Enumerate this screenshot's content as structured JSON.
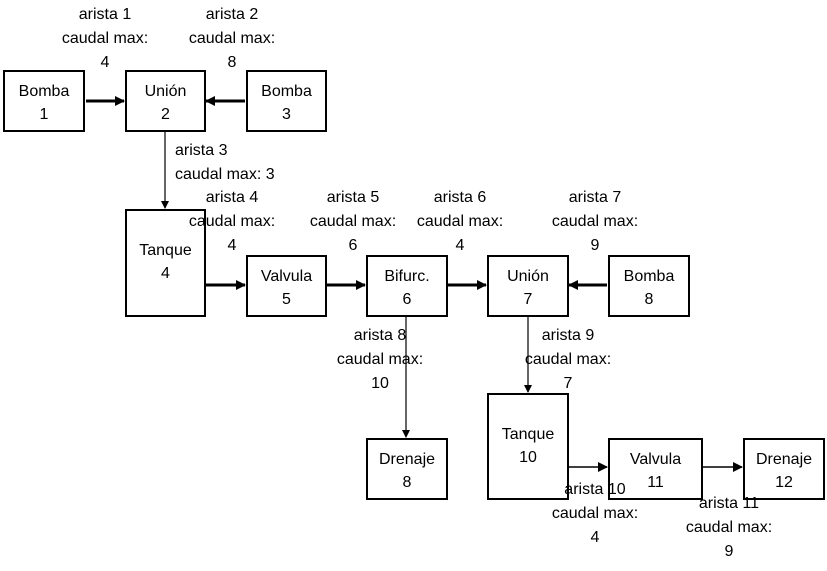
{
  "nodes": [
    {
      "id": "1",
      "type": "Bomba",
      "number": "1"
    },
    {
      "id": "2",
      "type": "Unión",
      "number": "2"
    },
    {
      "id": "3",
      "type": "Bomba",
      "number": "3"
    },
    {
      "id": "4",
      "type": "Tanque",
      "number": "4"
    },
    {
      "id": "5",
      "type": "Valvula",
      "number": "5"
    },
    {
      "id": "6",
      "type": "Bifurc.",
      "number": "6"
    },
    {
      "id": "7",
      "type": "Unión",
      "number": "7"
    },
    {
      "id": "8",
      "type": "Bomba",
      "number": "8"
    },
    {
      "id": "9",
      "type": "Drenaje",
      "number": "8"
    },
    {
      "id": "10",
      "type": "Tanque",
      "number": "10"
    },
    {
      "id": "11",
      "type": "Valvula",
      "number": "11"
    },
    {
      "id": "12",
      "type": "Drenaje",
      "number": "12"
    }
  ],
  "edges": [
    {
      "label": "arista 1",
      "caudal_label": "caudal max:",
      "value": "4",
      "from": "Bomba 1",
      "to": "Unión 2"
    },
    {
      "label": "arista 2",
      "caudal_label": "caudal max:",
      "value": "8",
      "from": "Bomba 3",
      "to": "Unión 2"
    },
    {
      "label": "arista 3",
      "caudal_label": "caudal max: 3",
      "value": "",
      "from": "Unión 2",
      "to": "Tanque 4"
    },
    {
      "label": "arista 4",
      "caudal_label": "caudal max:",
      "value": "4",
      "from": "Tanque 4",
      "to": "Valvula 5"
    },
    {
      "label": "arista 5",
      "caudal_label": "caudal max:",
      "value": "6",
      "from": "Valvula 5",
      "to": "Bifurc. 6"
    },
    {
      "label": "arista 6",
      "caudal_label": "caudal max:",
      "value": "4",
      "from": "Bifurc. 6",
      "to": "Unión 7"
    },
    {
      "label": "arista 7",
      "caudal_label": "caudal max:",
      "value": "9",
      "from": "Bomba 8",
      "to": "Unión 7"
    },
    {
      "label": "arista 8",
      "caudal_label": "caudal max:",
      "value": "10",
      "from": "Bifurc. 6",
      "to": "Drenaje 8"
    },
    {
      "label": "arista 9",
      "caudal_label": "caudal max:",
      "value": "7",
      "from": "Unión 7",
      "to": "Tanque 10"
    },
    {
      "label": "arista 10",
      "caudal_label": "caudal max:",
      "value": "4",
      "from": "Tanque 10",
      "to": "Valvula 11"
    },
    {
      "label": "arista 11",
      "caudal_label": "caudal max:",
      "value": "9",
      "from": "Valvula 11",
      "to": "Drenaje 12"
    }
  ]
}
